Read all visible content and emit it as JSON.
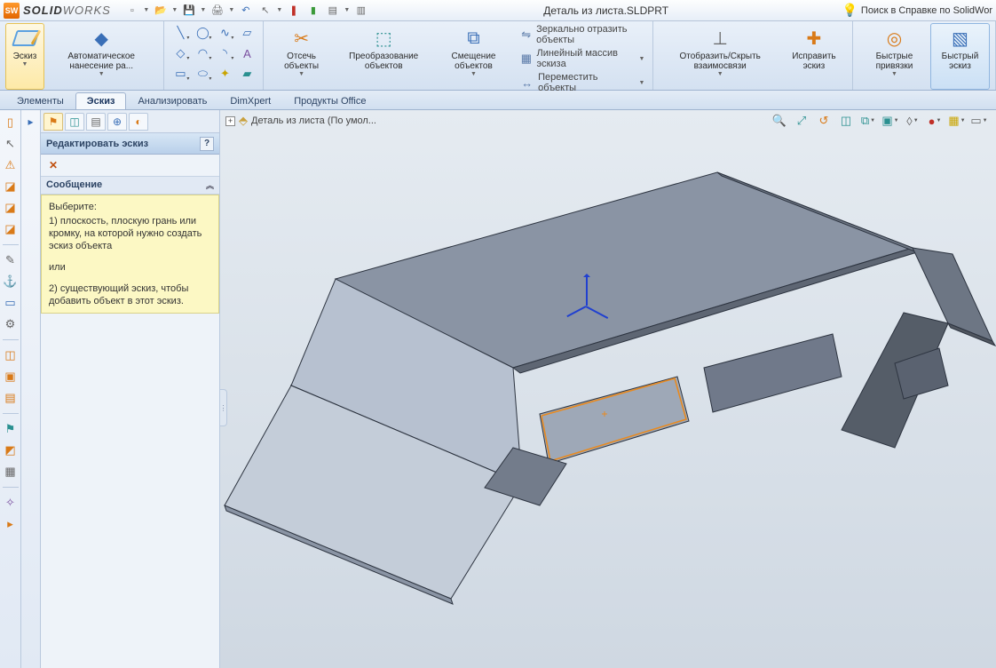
{
  "app": {
    "brand_bold": "SOLID",
    "brand_light": "WORKS",
    "logo": "SW"
  },
  "doc": {
    "name": "Деталь из листа.SLDPRT"
  },
  "search": {
    "label": "Поиск в Справке по SolidWor"
  },
  "qat": [
    {
      "n": "new-icon",
      "g": "▫",
      "c": "c-gray",
      "dd": true
    },
    {
      "n": "open-icon",
      "g": "📂",
      "c": "c-orange",
      "dd": true
    },
    {
      "n": "save-icon",
      "g": "💾",
      "c": "c-blue",
      "dd": true
    },
    {
      "n": "print-icon",
      "g": "🖨",
      "c": "c-gray",
      "dd": true
    },
    {
      "n": "undo-icon",
      "g": "↶",
      "c": "c-blue"
    },
    {
      "n": "select-icon",
      "g": "↖",
      "c": "c-gray",
      "dd": true
    },
    {
      "n": "rebuild-icon",
      "g": "❚",
      "c": "c-red"
    },
    {
      "n": "rebuild2-icon",
      "g": "▮",
      "c": "c-green"
    },
    {
      "n": "options-icon",
      "g": "▤",
      "c": "c-gray",
      "dd": true
    },
    {
      "n": "props-icon",
      "g": "▥",
      "c": "c-gray"
    }
  ],
  "ribbon": {
    "sketch_btn": "Эскиз",
    "smart_dim": "Автоматическое\nнанесение ра...",
    "trim": "Отсечь\nобъекты",
    "convert": "Преобразование\nобъектов",
    "offset": "Смещение\nобъектов",
    "mirror": "Зеркально отразить объекты",
    "linear": "Линейный массив эскиза",
    "move": "Переместить объекты",
    "showhide": "Отобразить/Скрыть\nвзаимосвязи",
    "repair": "Исправить\nэскиз",
    "quicksnap": "Быстрые\nпривязки",
    "rapid": "Быстрый\nэскиз",
    "tools": [
      {
        "n": "line-icon",
        "g": "╲",
        "c": "c-blue",
        "dd": true
      },
      {
        "n": "circle-icon",
        "g": "◯",
        "c": "c-blue",
        "dd": true
      },
      {
        "n": "spline-icon",
        "g": "∿",
        "c": "c-blue",
        "dd": true
      },
      {
        "n": "rect-icon",
        "g": "▱",
        "c": "c-blue"
      },
      {
        "n": "poly-icon",
        "g": "◇",
        "c": "c-blue",
        "dd": true
      },
      {
        "n": "arc-icon",
        "g": "◠",
        "c": "c-blue",
        "dd": true
      },
      {
        "n": "fillet-icon",
        "g": "◝",
        "c": "c-blue",
        "dd": true
      },
      {
        "n": "text-icon",
        "g": "A",
        "c": "c-purple"
      },
      {
        "n": "slot-icon",
        "g": "▭",
        "c": "c-blue",
        "dd": true
      },
      {
        "n": "ellipse-icon",
        "g": "⬭",
        "c": "c-blue",
        "dd": true
      },
      {
        "n": "point-icon",
        "g": "✦",
        "c": "c-yellow"
      },
      {
        "n": "plane-icon",
        "g": "▰",
        "c": "c-teal"
      }
    ]
  },
  "tabs": [
    {
      "n": "tab-features",
      "t": "Элементы"
    },
    {
      "n": "tab-sketch",
      "t": "Эскиз",
      "active": true
    },
    {
      "n": "tab-evaluate",
      "t": "Анализировать"
    },
    {
      "n": "tab-dimxpert",
      "t": "DimXpert"
    },
    {
      "n": "tab-office",
      "t": "Продукты Office"
    }
  ],
  "leftcol": [
    {
      "n": "filter-icon",
      "g": "▯",
      "c": "c-orange"
    },
    {
      "n": "select2-icon",
      "g": "↖",
      "c": "c-gray"
    },
    {
      "n": "warn-icon",
      "g": "⚠",
      "c": "c-orange"
    },
    {
      "n": "sheet-icon",
      "g": "◪",
      "c": "c-orange"
    },
    {
      "n": "sheet2-icon",
      "g": "◪",
      "c": "c-orange"
    },
    {
      "n": "sheet3-icon",
      "g": "◪",
      "c": "c-orange"
    },
    {
      "sep": true
    },
    {
      "n": "curve-icon",
      "g": "✎",
      "c": "c-gray"
    },
    {
      "n": "anchor-icon",
      "g": "⚓",
      "c": "c-teal"
    },
    {
      "n": "slot2-icon",
      "g": "▭",
      "c": "c-blue"
    },
    {
      "n": "gear-icon",
      "g": "⚙",
      "c": "c-gray"
    },
    {
      "sep": true
    },
    {
      "n": "cube-icon",
      "g": "◫",
      "c": "c-orange"
    },
    {
      "n": "cube2-icon",
      "g": "▣",
      "c": "c-orange"
    },
    {
      "n": "cube3-icon",
      "g": "▤",
      "c": "c-orange"
    },
    {
      "sep": true
    },
    {
      "n": "flag-icon",
      "g": "⚑",
      "c": "c-teal"
    },
    {
      "n": "flag2-icon",
      "g": "◩",
      "c": "c-orange"
    },
    {
      "n": "flag3-icon",
      "g": "▦",
      "c": "c-gray"
    },
    {
      "sep": true
    },
    {
      "n": "misc-icon",
      "g": "✧",
      "c": "c-purple"
    },
    {
      "n": "misc2-icon",
      "g": "▸",
      "c": "c-orange"
    }
  ],
  "pm": {
    "tabs": [
      {
        "n": "pm-tab-feature",
        "g": "⚑",
        "c": "c-orange",
        "active": true
      },
      {
        "n": "pm-tab-tree",
        "g": "◫",
        "c": "c-teal"
      },
      {
        "n": "pm-tab-sheet",
        "g": "▤",
        "c": "c-gray"
      },
      {
        "n": "pm-tab-draft",
        "g": "⊕",
        "c": "c-blue"
      },
      {
        "n": "pm-tab-render",
        "g": "◐",
        "c": "c-orange"
      }
    ],
    "title": "Редактировать эскиз",
    "section": "Сообщение",
    "msg_l1": "Выберите:",
    "msg_l2": "1) плоскость, плоскую грань или кромку, на которой нужно создать эскиз объекта",
    "msg_or": "или",
    "msg_l3": "2) существующий эскиз, чтобы добавить объект в этот эскиз."
  },
  "breadcrumb": {
    "text": "Деталь из листа  (По умол..."
  },
  "viewbar": [
    {
      "n": "zoomfit-icon",
      "g": "🔍",
      "c": "c-teal"
    },
    {
      "n": "zoomarea-icon",
      "g": "⤢",
      "c": "c-teal"
    },
    {
      "n": "prev-icon",
      "g": "↺",
      "c": "c-orange"
    },
    {
      "n": "section-icon",
      "g": "◫",
      "c": "c-teal"
    },
    {
      "n": "orient-icon",
      "g": "⧉",
      "c": "c-teal",
      "dd": true
    },
    {
      "n": "display-icon",
      "g": "▣",
      "c": "c-teal",
      "dd": true
    },
    {
      "n": "hide-icon",
      "g": "◊",
      "c": "c-gray",
      "dd": true
    },
    {
      "n": "appear-icon",
      "g": "●",
      "c": "c-red",
      "dd": true
    },
    {
      "n": "scene-icon",
      "g": "▦",
      "c": "c-yellow",
      "dd": true
    },
    {
      "n": "render-icon",
      "g": "▭",
      "c": "c-gray",
      "dd": true
    }
  ]
}
